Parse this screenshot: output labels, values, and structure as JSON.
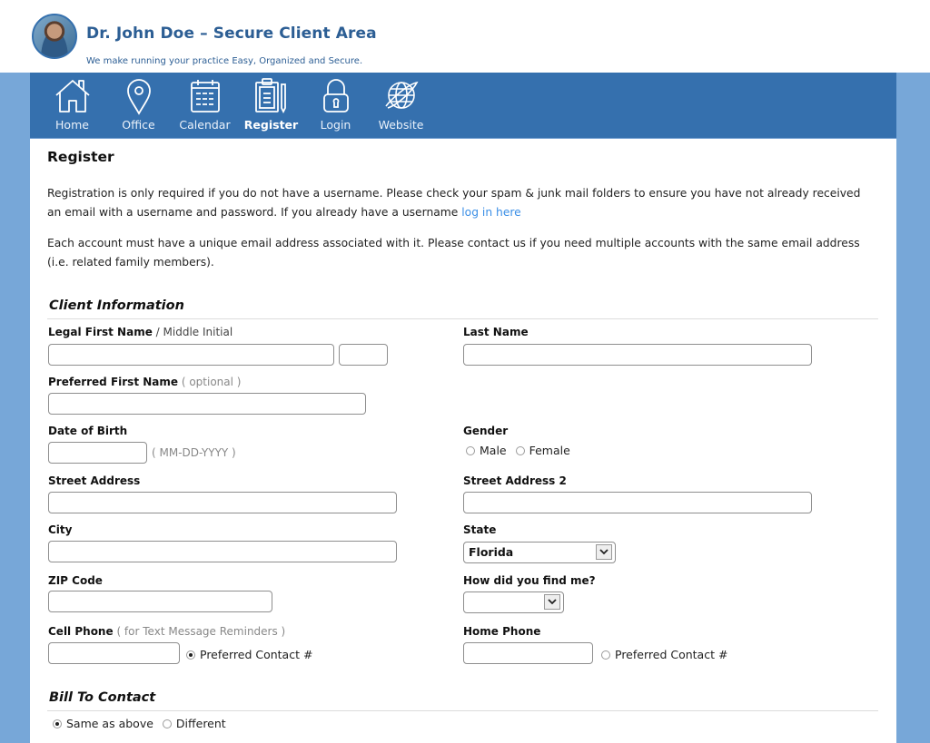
{
  "header": {
    "title": "Dr. John Doe – Secure Client Area",
    "tagline": "We make running your practice Easy, Organized and Secure."
  },
  "nav": {
    "items": [
      {
        "label": "Home",
        "icon": "home-icon",
        "active": false
      },
      {
        "label": "Office",
        "icon": "map-pin-icon",
        "active": false
      },
      {
        "label": "Calendar",
        "icon": "calendar-icon",
        "active": false
      },
      {
        "label": "Register",
        "icon": "clipboard-pencil-icon",
        "active": true
      },
      {
        "label": "Login",
        "icon": "padlock-icon",
        "active": false
      },
      {
        "label": "Website",
        "icon": "globe-icon",
        "active": false
      }
    ]
  },
  "page": {
    "title": "Register",
    "intro1": "Registration is only required if you do not have a username. Please check your spam & junk mail folders to ensure you have not already received an email with a username and password. If you already have a username ",
    "intro1_link": "log in here",
    "intro2": "Each account must have a unique email address associated with it. Please contact us if you need multiple accounts with the same email address (i.e. related family members)."
  },
  "client_info": {
    "section_title": "Client Information",
    "legal_first_name": {
      "label": "Legal First Name",
      "sub": " / Middle Initial",
      "value": "",
      "middle_value": ""
    },
    "last_name": {
      "label": "Last Name",
      "value": ""
    },
    "preferred_first_name": {
      "label": "Preferred First Name",
      "hint": " ( optional )",
      "value": ""
    },
    "dob": {
      "label": "Date of Birth",
      "hint": "( MM-DD-YYYY )",
      "value": ""
    },
    "gender": {
      "label": "Gender",
      "options": [
        "Male",
        "Female"
      ],
      "selected": null
    },
    "street1": {
      "label": "Street Address",
      "value": ""
    },
    "street2": {
      "label": "Street Address 2",
      "value": ""
    },
    "city": {
      "label": "City",
      "value": ""
    },
    "state": {
      "label": "State",
      "value": "Florida"
    },
    "zip": {
      "label": "ZIP Code",
      "value": ""
    },
    "referral": {
      "label": "How did you find me?",
      "value": ""
    },
    "cell_phone": {
      "label": "Cell Phone",
      "hint": " ( for Text Message Reminders )",
      "value": "",
      "preferred_label": "Preferred Contact #",
      "preferred": true
    },
    "home_phone": {
      "label": "Home Phone",
      "value": "",
      "preferred_label": "Preferred Contact #",
      "preferred": false
    }
  },
  "bill_to": {
    "section_title": "Bill To Contact",
    "options": [
      "Same as above",
      "Different"
    ],
    "selected": "Same as above"
  },
  "colors": {
    "nav_bg": "#3570ae",
    "side_band": "#77a7d8",
    "title_text": "#2c5e94",
    "link": "#3a8ee6"
  }
}
